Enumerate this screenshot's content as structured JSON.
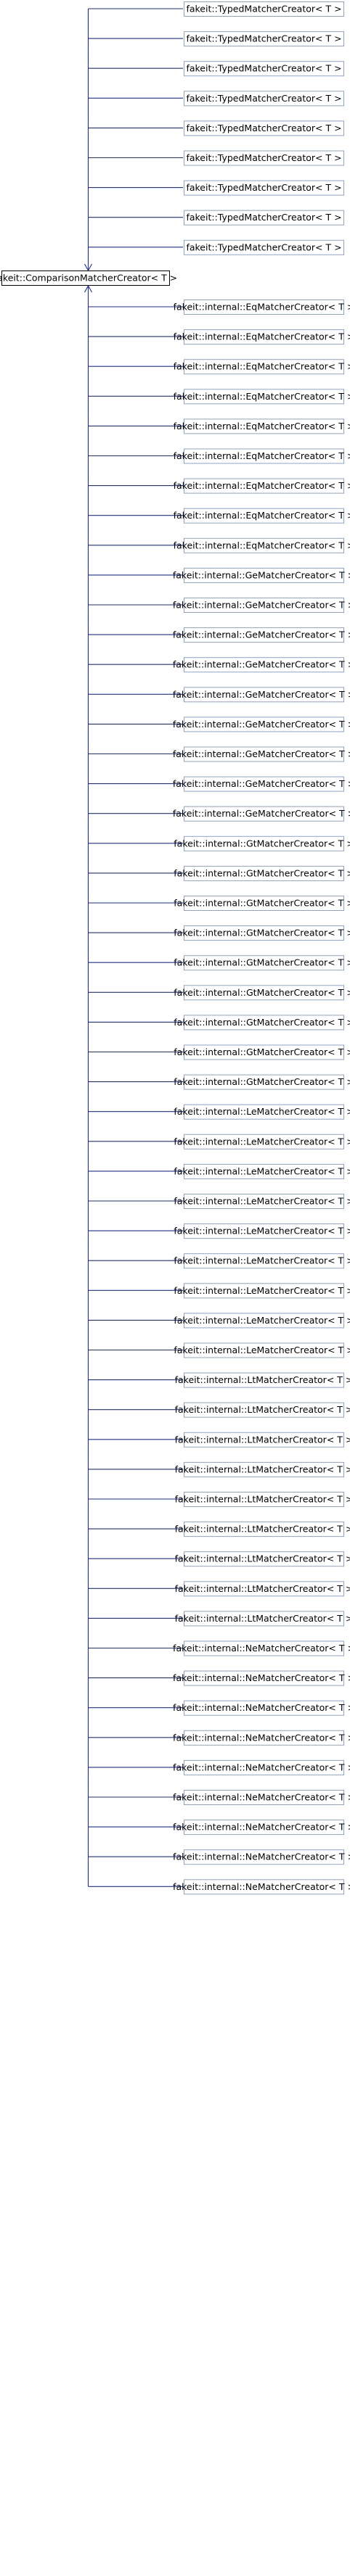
{
  "diagram": {
    "root": {
      "label": "fakeit::ComparisonMatcherCreator< T >"
    },
    "above_children": [
      "fakeit::TypedMatcherCreator< T >",
      "fakeit::TypedMatcherCreator< T >",
      "fakeit::TypedMatcherCreator< T >",
      "fakeit::TypedMatcherCreator< T >",
      "fakeit::TypedMatcherCreator< T >",
      "fakeit::TypedMatcherCreator< T >",
      "fakeit::TypedMatcherCreator< T >",
      "fakeit::TypedMatcherCreator< T >",
      "fakeit::TypedMatcherCreator< T >"
    ],
    "below_children": [
      "fakeit::internal::EqMatcherCreator< T >",
      "fakeit::internal::EqMatcherCreator< T >",
      "fakeit::internal::EqMatcherCreator< T >",
      "fakeit::internal::EqMatcherCreator< T >",
      "fakeit::internal::EqMatcherCreator< T >",
      "fakeit::internal::EqMatcherCreator< T >",
      "fakeit::internal::EqMatcherCreator< T >",
      "fakeit::internal::EqMatcherCreator< T >",
      "fakeit::internal::EqMatcherCreator< T >",
      "fakeit::internal::GeMatcherCreator< T >",
      "fakeit::internal::GeMatcherCreator< T >",
      "fakeit::internal::GeMatcherCreator< T >",
      "fakeit::internal::GeMatcherCreator< T >",
      "fakeit::internal::GeMatcherCreator< T >",
      "fakeit::internal::GeMatcherCreator< T >",
      "fakeit::internal::GeMatcherCreator< T >",
      "fakeit::internal::GeMatcherCreator< T >",
      "fakeit::internal::GeMatcherCreator< T >",
      "fakeit::internal::GtMatcherCreator< T >",
      "fakeit::internal::GtMatcherCreator< T >",
      "fakeit::internal::GtMatcherCreator< T >",
      "fakeit::internal::GtMatcherCreator< T >",
      "fakeit::internal::GtMatcherCreator< T >",
      "fakeit::internal::GtMatcherCreator< T >",
      "fakeit::internal::GtMatcherCreator< T >",
      "fakeit::internal::GtMatcherCreator< T >",
      "fakeit::internal::GtMatcherCreator< T >",
      "fakeit::internal::LeMatcherCreator< T >",
      "fakeit::internal::LeMatcherCreator< T >",
      "fakeit::internal::LeMatcherCreator< T >",
      "fakeit::internal::LeMatcherCreator< T >",
      "fakeit::internal::LeMatcherCreator< T >",
      "fakeit::internal::LeMatcherCreator< T >",
      "fakeit::internal::LeMatcherCreator< T >",
      "fakeit::internal::LeMatcherCreator< T >",
      "fakeit::internal::LeMatcherCreator< T >",
      "fakeit::internal::LtMatcherCreator< T >",
      "fakeit::internal::LtMatcherCreator< T >",
      "fakeit::internal::LtMatcherCreator< T >",
      "fakeit::internal::LtMatcherCreator< T >",
      "fakeit::internal::LtMatcherCreator< T >",
      "fakeit::internal::LtMatcherCreator< T >",
      "fakeit::internal::LtMatcherCreator< T >",
      "fakeit::internal::LtMatcherCreator< T >",
      "fakeit::internal::LtMatcherCreator< T >",
      "fakeit::internal::NeMatcherCreator< T >",
      "fakeit::internal::NeMatcherCreator< T >",
      "fakeit::internal::NeMatcherCreator< T >",
      "fakeit::internal::NeMatcherCreator< T >",
      "fakeit::internal::NeMatcherCreator< T >",
      "fakeit::internal::NeMatcherCreator< T >",
      "fakeit::internal::NeMatcherCreator< T >",
      "fakeit::internal::NeMatcherCreator< T >",
      "fakeit::internal::NeMatcherCreator< T >"
    ],
    "colors": {
      "edge": "#1b2e9a",
      "root_border": "#000000",
      "child_border": "#8fa3c8",
      "background": "#ffffff"
    }
  }
}
